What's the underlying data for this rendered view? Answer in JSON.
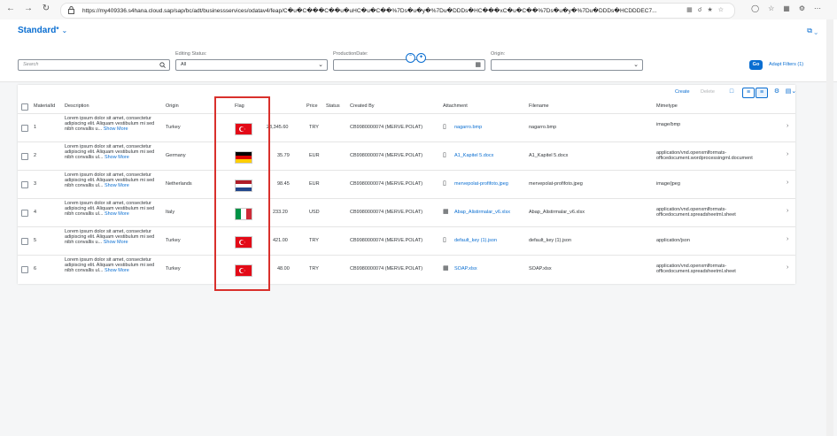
{
  "browser": {
    "back_icon": "arrow-left-icon",
    "forward_icon": "arrow-right-icon",
    "reload_icon": "reload-icon",
    "url": "https://my409336.s4hana.cloud.sap/sap/bc/adt/businessservices/odatav4/feap/C�u�C���C��u�uHC�u�C��%7Ds�u�y�%7Du�DDDs�HC���xC�u�C��%7Ds�u�y�%7Du�DDDs�HCDDDEC7..."
  },
  "header": {
    "variant_title": "Standard",
    "variant_modified": "*"
  },
  "filters": {
    "search_placeholder": "Search",
    "editing_status_label": "Editing Status:",
    "editing_status_value": "All",
    "production_date_label": "ProductionDate:",
    "production_date_value": "",
    "origin_label": "Origin:",
    "origin_value": "",
    "go_label": "Go",
    "adapt_filters_label": "Adapt Filters (1)"
  },
  "toolbar": {
    "create_label": "Create",
    "delete_label": "Delete"
  },
  "columns": [
    "MaterialId",
    "Description",
    "Origin",
    "Flag",
    "",
    "Price",
    "Status",
    "Created By",
    "Attachment",
    "Filename",
    "Mimetype"
  ],
  "rows": [
    {
      "id": "1",
      "desc": "Lorem ipsum dolor sit amet, consectetur adipiscing elit. Aliquam vestibulum mi sed nibh convallis u...",
      "more": "Show More",
      "origin": "Turkey",
      "flag": "turkey",
      "amount": "23,345.60",
      "currency": "TRY",
      "created_by": "CB9980000074 (MERVE.POLAT)",
      "attachment": "nagarro.bmp",
      "filename": "nagarro.bmp",
      "mime": "image/bmp",
      "mime2": ""
    },
    {
      "id": "2",
      "desc": "Lorem ipsum dolor sit amet, consectetur adipiscing elit. Aliquam vestibulum mi sed nibh convallis ul...",
      "more": "Show More",
      "origin": "Germany",
      "flag": "germany",
      "amount": "35.79",
      "currency": "EUR",
      "created_by": "CB9980000074 (MERVE.POLAT)",
      "attachment": "A1_Kapitel 5.docx",
      "filename": "A1_Kapitel 5.docx",
      "mime": "application/vnd.openxmlformats-",
      "mime2": "officedocument.wordprocessingml.document"
    },
    {
      "id": "3",
      "desc": "Lorem ipsum dolor sit amet, consectetur adipiscing elit. Aliquam vestibulum mi sed nibh convallis ul...",
      "more": "Show More",
      "origin": "Netherlands",
      "flag": "netherlands",
      "amount": "98.45",
      "currency": "EUR",
      "created_by": "CB9980000074 (MERVE.POLAT)",
      "attachment": "mervepolat-profifoto.jpeg",
      "filename": "mervepolat-profifoto.jpeg",
      "mime": "image/jpeg",
      "mime2": ""
    },
    {
      "id": "4",
      "desc": "Lorem ipsum dolor sit amet, consectetur adipiscing elit. Aliquam vestibulum mi sed nibh convallis ul...",
      "more": "Show More",
      "origin": "Italy",
      "flag": "italy",
      "amount": "233.20",
      "currency": "USD",
      "created_by": "CB9980000074 (MERVE.POLAT)",
      "attachment": "Abap_Alistirmalar_v6.xlsx",
      "filename": "Abap_Alistirmalar_v6.xlsx",
      "mime": "application/vnd.openxmlformats-",
      "mime2": "officedocument.spreadsheetml.sheet"
    },
    {
      "id": "5",
      "desc": "Lorem ipsum dolor sit amet, consectetur adipiscing elit. Aliquam vestibulum mi sed nibh convallis u...",
      "more": "Show More",
      "origin": "Turkey",
      "flag": "turkey",
      "amount": "421.00",
      "currency": "TRY",
      "created_by": "CB9980000074 (MERVE.POLAT)",
      "attachment": "default_key (1).json",
      "filename": "default_key (1).json",
      "mime": "application/json",
      "mime2": ""
    },
    {
      "id": "6",
      "desc": "Lorem ipsum dolor sit amet, consectetur adipiscing elit. Aliquam vestibulum mi sed nibh convallis ul...",
      "more": "Show More",
      "origin": "Turkey",
      "flag": "turkey",
      "amount": "48.00",
      "currency": "TRY",
      "created_by": "CB9980000074 (MERVE.POLAT)",
      "attachment": "SOAP.xlsx",
      "filename": "SOAP.xlsx",
      "mime": "application/vnd.openxmlformats-",
      "mime2": "officedocument.spreadsheetml.sheet"
    }
  ],
  "colors": {
    "accent": "#0a6ed1",
    "highlight": "#d9302c"
  }
}
